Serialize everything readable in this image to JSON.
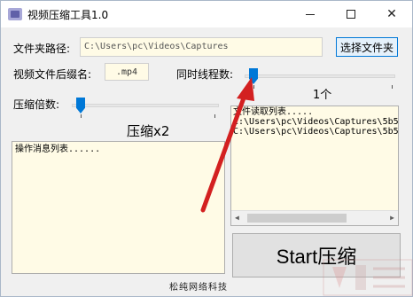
{
  "window": {
    "title": "视频压缩工具1.0",
    "controls": {
      "minimize": "—",
      "close": "✕"
    }
  },
  "folder": {
    "label": "文件夹路径:",
    "value": "C:\\Users\\pc\\Videos\\Captures",
    "select_button": "选择文件夹"
  },
  "suffix": {
    "label": "视频文件后缀名:",
    "value": ".mp4"
  },
  "threads": {
    "label": "同时线程数:",
    "value_text": "1个",
    "slider_fraction": 0.0
  },
  "compress": {
    "label": "压缩倍数:",
    "value_text": "压缩x2",
    "slider_fraction": 0.0
  },
  "file_list": {
    "lines": [
      "文件读取列表.....",
      "C:\\Users\\pc\\Videos\\Captures\\5b5",
      "C:\\Users\\pc\\Videos\\Captures\\5b5"
    ]
  },
  "message_list": {
    "header": "操作消息列表......"
  },
  "start_button": "Start压缩",
  "footer": "松纯网络科技",
  "colors": {
    "accent": "#0078d7",
    "input_bg": "#fffbe6",
    "annotation_arrow": "#d32020"
  }
}
